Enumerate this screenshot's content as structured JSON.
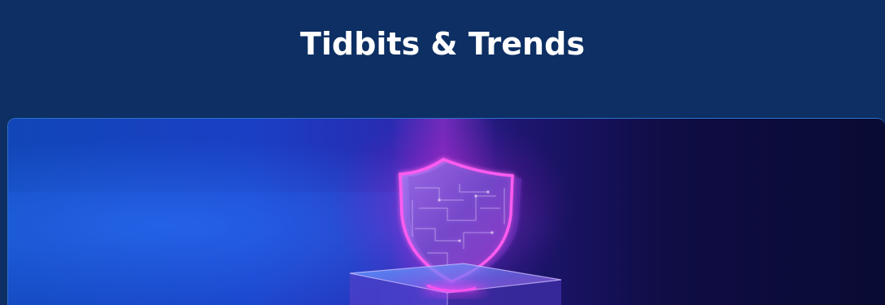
{
  "section": {
    "title": "Tidbits & Trends"
  },
  "card": {
    "image_icon": "shield-circuit-icon"
  },
  "colors": {
    "background": "#0d2f63",
    "title": "#ffffff",
    "card_border": "#2f72c8",
    "neon_accent": "#ff3df5"
  }
}
